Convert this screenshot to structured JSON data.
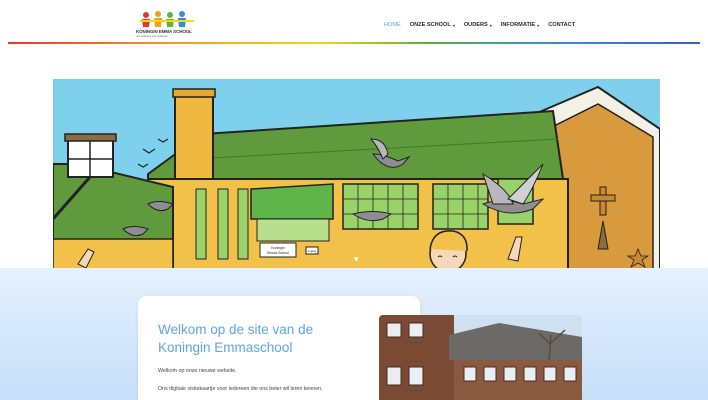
{
  "header": {
    "logo_text": "KONINGIN EMMA SCHOOL",
    "logo_subtext": "met iedereen voor iedereen",
    "nav": [
      {
        "label": "HOME",
        "active": true,
        "dropdown": false
      },
      {
        "label": "ONZE SCHOOL",
        "active": false,
        "dropdown": true
      },
      {
        "label": "OUDERS",
        "active": false,
        "dropdown": true
      },
      {
        "label": "INFORMATIE",
        "active": false,
        "dropdown": true
      },
      {
        "label": "CONTACT",
        "active": false,
        "dropdown": false
      }
    ],
    "caret_glyph": "▾"
  },
  "hero": {
    "sign_text_1": "Koningin",
    "sign_text_2": "Emma School",
    "sign_text_3": "ingang"
  },
  "welcome": {
    "title": "Welkom op de site van de Koningin Emmaschool",
    "paragraph_1": "Welkom op onze nieuwe website.",
    "paragraph_2": "Ons digitale visitekaartje voor iedereen die ons beter wil leren kennen."
  },
  "colors": {
    "accent": "#5aa8e6",
    "roof": "#5f9a3c",
    "wall": "#f2c14a",
    "sky": "#7fd0ec"
  }
}
